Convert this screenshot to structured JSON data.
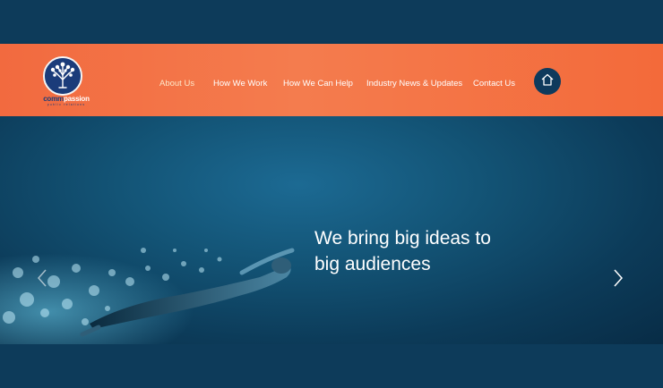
{
  "brand": {
    "name_part1": "comm",
    "name_part2": "passion",
    "tagline": "public relations"
  },
  "nav": {
    "items": [
      {
        "label": "About Us"
      },
      {
        "label": "How We Work"
      },
      {
        "label": "How We Can Help"
      },
      {
        "label": "Industry News & Updates"
      },
      {
        "label": "Contact Us"
      }
    ],
    "home_icon": "home-icon"
  },
  "hero": {
    "headline_line1": "We bring big ideas to",
    "headline_line2": "big audiences",
    "prev_icon": "chevron-left-icon",
    "next_icon": "chevron-right-icon"
  },
  "colors": {
    "header_orange": "#f47c4e",
    "page_navy": "#0d3b5a",
    "logo_blue": "#1b3c7a"
  }
}
